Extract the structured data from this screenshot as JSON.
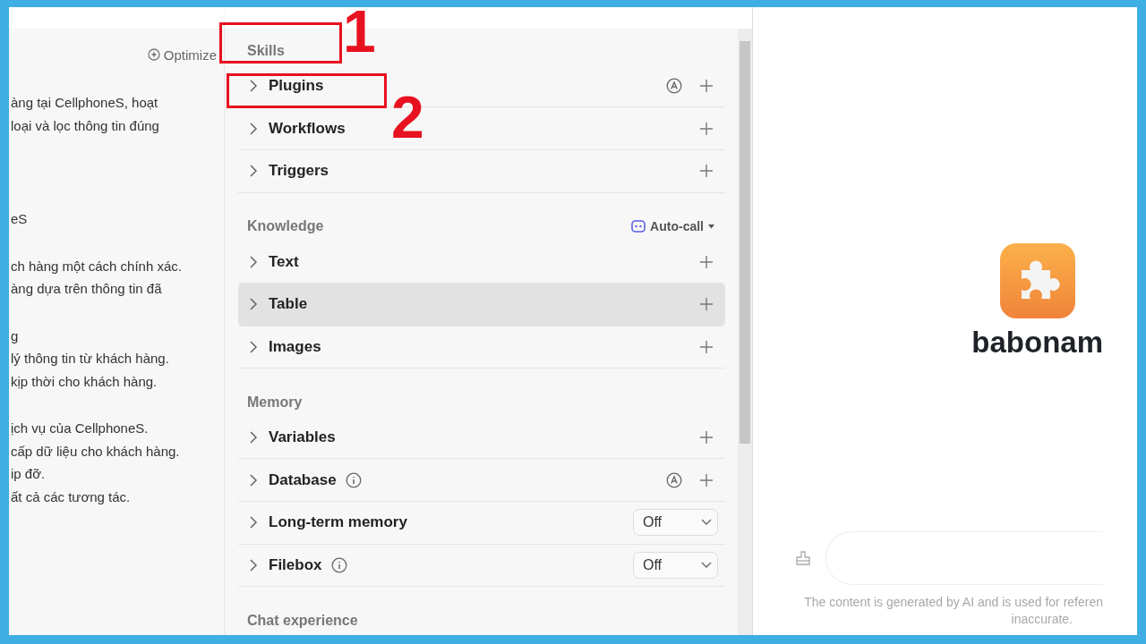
{
  "prompt_panel": {
    "optimize_button": "Optimize",
    "blocks": [
      [
        "àng tại CellphoneS, hoạt",
        "loại và lọc thông tin đúng"
      ],
      [
        "eS"
      ],
      [
        "ch hàng một cách chính xác.",
        "àng dựa trên thông tin đã"
      ],
      [
        "g",
        "lý thông tin từ khách hàng.",
        "kịp thời cho khách hàng."
      ],
      [
        "ịch vụ của CellphoneS.",
        "cấp dữ liệu cho khách hàng.",
        "ip đỡ.",
        "ất cả các tương tác."
      ]
    ]
  },
  "skills_panel": {
    "sections": [
      {
        "title": "Skills",
        "rows": [
          {
            "label": "Plugins",
            "kind": "add",
            "auto": true,
            "info": false,
            "highlighted": false
          },
          {
            "label": "Workflows",
            "kind": "add",
            "auto": false,
            "info": false,
            "highlighted": false
          },
          {
            "label": "Triggers",
            "kind": "add",
            "auto": false,
            "info": false,
            "highlighted": false
          }
        ]
      },
      {
        "title": "Knowledge",
        "mode": "Auto-call",
        "rows": [
          {
            "label": "Text",
            "kind": "add",
            "auto": false,
            "info": false,
            "highlighted": false
          },
          {
            "label": "Table",
            "kind": "add",
            "auto": false,
            "info": false,
            "highlighted": true
          },
          {
            "label": "Images",
            "kind": "add",
            "auto": false,
            "info": false,
            "highlighted": false
          }
        ]
      },
      {
        "title": "Memory",
        "rows": [
          {
            "label": "Variables",
            "kind": "add",
            "auto": false,
            "info": false,
            "highlighted": false
          },
          {
            "label": "Database",
            "kind": "add",
            "auto": true,
            "info": true,
            "highlighted": false
          },
          {
            "label": "Long-term memory",
            "kind": "select",
            "value": "Off",
            "info": false,
            "highlighted": false
          },
          {
            "label": "Filebox",
            "kind": "select",
            "value": "Off",
            "info": true,
            "highlighted": false
          }
        ]
      },
      {
        "title": "Chat experience"
      }
    ]
  },
  "preview": {
    "bot_name": "babonam",
    "disclaimer": [
      "The content is generated by AI and is used for referen",
      "inaccurate."
    ]
  },
  "annotations": [
    {
      "number": "1"
    },
    {
      "number": "2"
    }
  ]
}
